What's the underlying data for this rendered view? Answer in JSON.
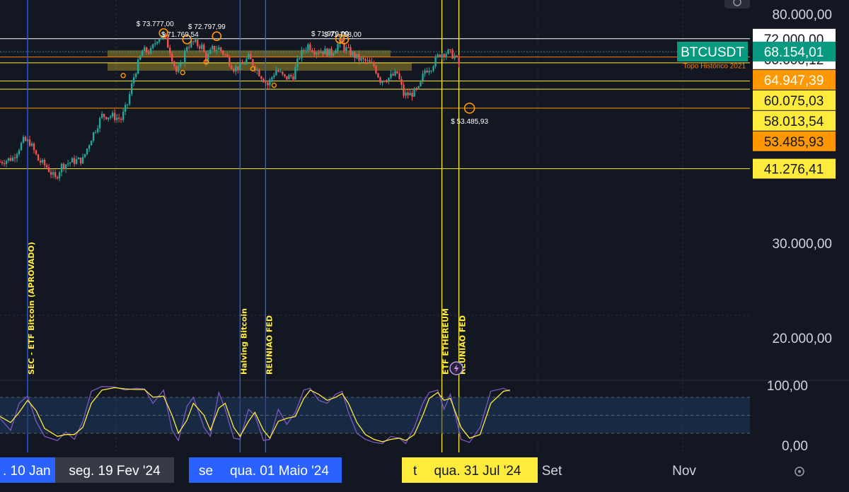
{
  "chart_data": {
    "type": "candlestick",
    "symbol": "BTCUSDT",
    "last_price": "68.154,01",
    "y_axis": {
      "ticks": [
        {
          "value": 80000,
          "label": "80.000,00"
        },
        {
          "value": 30000,
          "label": "30.000,00"
        },
        {
          "value": 20000,
          "label": "20.000,00"
        }
      ],
      "ylim": [
        8000,
        84000
      ]
    },
    "price_lines": [
      {
        "value": 72000,
        "label": "72.000,00",
        "line": "#ffffff",
        "tag_bg": "#ffffff",
        "tag_fg": "#131722"
      },
      {
        "value": 66600.12,
        "label": "66.600,12",
        "line": "#f57c00",
        "tag_bg": "#ffffff",
        "tag_fg": "#131722"
      },
      {
        "value": 64947.39,
        "label": "64.947,39",
        "line": "#ffeb3b",
        "tag_bg": "#ff9800",
        "tag_fg": "#ffffff"
      },
      {
        "value": 60075.03,
        "label": "60.075,03",
        "line": "#ffeb3b",
        "tag_bg": "#ffeb3b",
        "tag_fg": "#131722"
      },
      {
        "value": 58013.54,
        "label": "58.013,54",
        "line": "#ffeb3b",
        "tag_bg": "#ffeb3b",
        "tag_fg": "#131722"
      },
      {
        "value": 53485.93,
        "label": "53.485,93",
        "line": "#ff9800",
        "tag_bg": "#ff9800",
        "tag_fg": "#131722"
      },
      {
        "value": 41276.41,
        "label": "41.276,41",
        "line": "#ffeb3b",
        "tag_bg": "#ffeb3b",
        "tag_fg": "#131722"
      }
    ],
    "resistance_note": "Topo Histórico 2021",
    "annotations": [
      {
        "date": "2024-03-14",
        "value": 73777,
        "label": "$ 73.777,00"
      },
      {
        "date": "2024-03-25",
        "value": 71769.54,
        "label": "$ 71.769,54"
      },
      {
        "date": "2024-04-08",
        "value": 72797.99,
        "label": "$ 72.797,99"
      },
      {
        "date": "2024-06-05",
        "value": 71979,
        "label": "$ 71.979,00"
      },
      {
        "date": "2024-06-07",
        "value": 71758,
        "label": "$ 71.758,00"
      },
      {
        "date": "2024-08-05",
        "value": 53485.93,
        "label": "$ 53.485,93"
      }
    ],
    "events": [
      {
        "date": "2024-01-10",
        "label": "SEC - ETF Bitcoin (APROVADO)",
        "color": "#2962ff"
      },
      {
        "date": "2024-04-19",
        "label": "Halving Bitcoin",
        "color": "#2962ff"
      },
      {
        "date": "2024-05-01",
        "label": "REUNIAO FED",
        "color": "#2962ff"
      },
      {
        "date": "2024-07-23",
        "label": "ETF ETHEREUM",
        "color": "#ffeb3b"
      },
      {
        "date": "2024-07-31",
        "label": "REUNIÃO FED",
        "color": "#ffeb3b"
      }
    ],
    "x_axis": {
      "date_range": [
        "2023-12-28",
        "2024-12-15"
      ],
      "labels": [
        {
          "date": "2024-01-10",
          "text": ". 10 Jan",
          "bg": "#2962ff",
          "fg": "#ffffff"
        },
        {
          "date": "2024-02-19",
          "text": "seg. 19 Fev '24",
          "bg": "#363a45",
          "fg": "#ffffff"
        },
        {
          "date": "2024-04-19",
          "text": "se",
          "bg": "#2962ff",
          "fg": "#ffffff"
        },
        {
          "date": "2024-05-01",
          "text": "qua. 01 Maio '24",
          "bg": "#2962ff",
          "fg": "#ffffff"
        },
        {
          "date": "2024-07-23",
          "text": "t",
          "bg": "#ffeb3b",
          "fg": "#131722"
        },
        {
          "date": "2024-07-31",
          "text": "qua. 31 Jul '24",
          "bg": "#ffeb3b",
          "fg": "#131722"
        },
        {
          "date": "2024-09-01",
          "text": "Set",
          "bg": "",
          "fg": "#d1d4dc"
        },
        {
          "date": "2024-11-01",
          "text": "Nov",
          "bg": "",
          "fg": "#d1d4dc"
        }
      ]
    },
    "candles_close_path": [
      [
        "2023-12-28",
        42500
      ],
      [
        "2024-01-03",
        43200
      ],
      [
        "2024-01-08",
        46500
      ],
      [
        "2024-01-11",
        46200
      ],
      [
        "2024-01-15",
        42800
      ],
      [
        "2024-01-19",
        41600
      ],
      [
        "2024-01-23",
        39500
      ],
      [
        "2024-01-26",
        41800
      ],
      [
        "2024-01-31",
        42600
      ],
      [
        "2024-02-05",
        42900
      ],
      [
        "2024-02-09",
        47100
      ],
      [
        "2024-02-14",
        51800
      ],
      [
        "2024-02-19",
        51700
      ],
      [
        "2024-02-23",
        51000
      ],
      [
        "2024-02-26",
        54500
      ],
      [
        "2024-02-29",
        61200
      ],
      [
        "2024-03-04",
        68300
      ],
      [
        "2024-03-08",
        68200
      ],
      [
        "2024-03-11",
        72100
      ],
      [
        "2024-03-14",
        73100
      ],
      [
        "2024-03-17",
        68400
      ],
      [
        "2024-03-20",
        62500
      ],
      [
        "2024-03-22",
        63800
      ],
      [
        "2024-03-25",
        70000
      ],
      [
        "2024-03-28",
        70800
      ],
      [
        "2024-04-01",
        69600
      ],
      [
        "2024-04-03",
        65900
      ],
      [
        "2024-04-06",
        68900
      ],
      [
        "2024-04-09",
        69100
      ],
      [
        "2024-04-12",
        67100
      ],
      [
        "2024-04-16",
        63500
      ],
      [
        "2024-04-19",
        63800
      ],
      [
        "2024-04-23",
        66400
      ],
      [
        "2024-04-26",
        63800
      ],
      [
        "2024-04-30",
        60600
      ],
      [
        "2024-05-02",
        59100
      ],
      [
        "2024-05-06",
        63100
      ],
      [
        "2024-05-10",
        60800
      ],
      [
        "2024-05-14",
        61500
      ],
      [
        "2024-05-17",
        66900
      ],
      [
        "2024-05-21",
        70100
      ],
      [
        "2024-05-24",
        68500
      ],
      [
        "2024-05-28",
        68300
      ],
      [
        "2024-06-01",
        67700
      ],
      [
        "2024-06-05",
        71100
      ],
      [
        "2024-06-07",
        69300
      ],
      [
        "2024-06-11",
        67300
      ],
      [
        "2024-06-14",
        66000
      ],
      [
        "2024-06-18",
        65100
      ],
      [
        "2024-06-21",
        64100
      ],
      [
        "2024-06-24",
        60300
      ],
      [
        "2024-06-28",
        60900
      ],
      [
        "2024-07-02",
        62100
      ],
      [
        "2024-07-05",
        56700
      ],
      [
        "2024-07-08",
        56700
      ],
      [
        "2024-07-12",
        57900
      ],
      [
        "2024-07-15",
        62900
      ],
      [
        "2024-07-18",
        63900
      ],
      [
        "2024-07-22",
        67600
      ],
      [
        "2024-07-26",
        67900
      ],
      [
        "2024-07-29",
        66800
      ],
      [
        "2024-07-31",
        64600
      ]
    ],
    "oscillator": {
      "ticks": [
        {
          "value": 100,
          "label": "100,00"
        },
        {
          "value": 0,
          "label": "0,00"
        }
      ],
      "upper_band": 80,
      "lower_band": 20,
      "k_path": [
        [
          "2023-12-28",
          45
        ],
        [
          "2024-01-02",
          25
        ],
        [
          "2024-01-06",
          70
        ],
        [
          "2024-01-10",
          82
        ],
        [
          "2024-01-14",
          40
        ],
        [
          "2024-01-18",
          15
        ],
        [
          "2024-01-24",
          8
        ],
        [
          "2024-01-28",
          22
        ],
        [
          "2024-02-01",
          10
        ],
        [
          "2024-02-05",
          40
        ],
        [
          "2024-02-09",
          90
        ],
        [
          "2024-02-14",
          98
        ],
        [
          "2024-02-20",
          97
        ],
        [
          "2024-02-25",
          92
        ],
        [
          "2024-03-01",
          95
        ],
        [
          "2024-03-05",
          94
        ],
        [
          "2024-03-09",
          70
        ],
        [
          "2024-03-14",
          92
        ],
        [
          "2024-03-18",
          25
        ],
        [
          "2024-03-21",
          8
        ],
        [
          "2024-03-25",
          65
        ],
        [
          "2024-03-28",
          80
        ],
        [
          "2024-04-02",
          30
        ],
        [
          "2024-04-05",
          15
        ],
        [
          "2024-04-09",
          88
        ],
        [
          "2024-04-12",
          60
        ],
        [
          "2024-04-16",
          12
        ],
        [
          "2024-04-19",
          10
        ],
        [
          "2024-04-23",
          60
        ],
        [
          "2024-04-26",
          50
        ],
        [
          "2024-04-30",
          8
        ],
        [
          "2024-05-03",
          10
        ],
        [
          "2024-05-07",
          60
        ],
        [
          "2024-05-11",
          35
        ],
        [
          "2024-05-15",
          55
        ],
        [
          "2024-05-19",
          92
        ],
        [
          "2024-05-22",
          95
        ],
        [
          "2024-05-26",
          75
        ],
        [
          "2024-05-30",
          70
        ],
        [
          "2024-06-03",
          85
        ],
        [
          "2024-06-06",
          90
        ],
        [
          "2024-06-09",
          55
        ],
        [
          "2024-06-13",
          20
        ],
        [
          "2024-06-17",
          10
        ],
        [
          "2024-06-21",
          5
        ],
        [
          "2024-06-25",
          3
        ],
        [
          "2024-06-29",
          15
        ],
        [
          "2024-07-03",
          12
        ],
        [
          "2024-07-06",
          3
        ],
        [
          "2024-07-10",
          30
        ],
        [
          "2024-07-14",
          70
        ],
        [
          "2024-07-17",
          88
        ],
        [
          "2024-07-21",
          92
        ],
        [
          "2024-07-24",
          60
        ],
        [
          "2024-07-27",
          85
        ],
        [
          "2024-08-01",
          10
        ],
        [
          "2024-08-05",
          5
        ],
        [
          "2024-08-10",
          30
        ],
        [
          "2024-08-15",
          90
        ],
        [
          "2024-08-21",
          95
        ],
        [
          "2024-08-24",
          90
        ]
      ],
      "d_path": [
        [
          "2023-12-28",
          48
        ],
        [
          "2024-01-02",
          38
        ],
        [
          "2024-01-06",
          55
        ],
        [
          "2024-01-10",
          75
        ],
        [
          "2024-01-14",
          58
        ],
        [
          "2024-01-18",
          28
        ],
        [
          "2024-01-24",
          15
        ],
        [
          "2024-01-28",
          18
        ],
        [
          "2024-02-01",
          18
        ],
        [
          "2024-02-05",
          30
        ],
        [
          "2024-02-09",
          70
        ],
        [
          "2024-02-14",
          92
        ],
        [
          "2024-02-20",
          96
        ],
        [
          "2024-02-25",
          94
        ],
        [
          "2024-03-01",
          93
        ],
        [
          "2024-03-05",
          93
        ],
        [
          "2024-03-09",
          80
        ],
        [
          "2024-03-14",
          82
        ],
        [
          "2024-03-18",
          50
        ],
        [
          "2024-03-21",
          20
        ],
        [
          "2024-03-25",
          42
        ],
        [
          "2024-03-28",
          70
        ],
        [
          "2024-04-02",
          50
        ],
        [
          "2024-04-05",
          25
        ],
        [
          "2024-04-09",
          62
        ],
        [
          "2024-04-12",
          70
        ],
        [
          "2024-04-16",
          30
        ],
        [
          "2024-04-19",
          15
        ],
        [
          "2024-04-23",
          40
        ],
        [
          "2024-04-26",
          55
        ],
        [
          "2024-04-30",
          25
        ],
        [
          "2024-05-03",
          12
        ],
        [
          "2024-05-07",
          40
        ],
        [
          "2024-05-11",
          45
        ],
        [
          "2024-05-15",
          48
        ],
        [
          "2024-05-19",
          78
        ],
        [
          "2024-05-22",
          92
        ],
        [
          "2024-05-26",
          85
        ],
        [
          "2024-05-30",
          75
        ],
        [
          "2024-06-03",
          80
        ],
        [
          "2024-06-06",
          86
        ],
        [
          "2024-06-09",
          70
        ],
        [
          "2024-06-13",
          38
        ],
        [
          "2024-06-17",
          18
        ],
        [
          "2024-06-21",
          10
        ],
        [
          "2024-06-25",
          6
        ],
        [
          "2024-06-29",
          10
        ],
        [
          "2024-07-03",
          12
        ],
        [
          "2024-07-06",
          8
        ],
        [
          "2024-07-10",
          18
        ],
        [
          "2024-07-14",
          50
        ],
        [
          "2024-07-17",
          78
        ],
        [
          "2024-07-21",
          88
        ],
        [
          "2024-07-24",
          75
        ],
        [
          "2024-07-27",
          78
        ],
        [
          "2024-08-01",
          30
        ],
        [
          "2024-08-05",
          12
        ],
        [
          "2024-08-10",
          18
        ],
        [
          "2024-08-15",
          70
        ],
        [
          "2024-08-21",
          90
        ],
        [
          "2024-08-24",
          92
        ]
      ]
    }
  },
  "colors": {
    "background": "#131722",
    "bull": "#26a69a",
    "bear": "#ef5350",
    "osc_k": "#7e57c2",
    "osc_d": "#ffeb3b",
    "zone": "#b8a22a"
  },
  "symbol_tag_bg": "#089981",
  "icons": {
    "alert": "lightning-icon",
    "settings": "gear-icon",
    "menu": "ellipsis-icon"
  }
}
